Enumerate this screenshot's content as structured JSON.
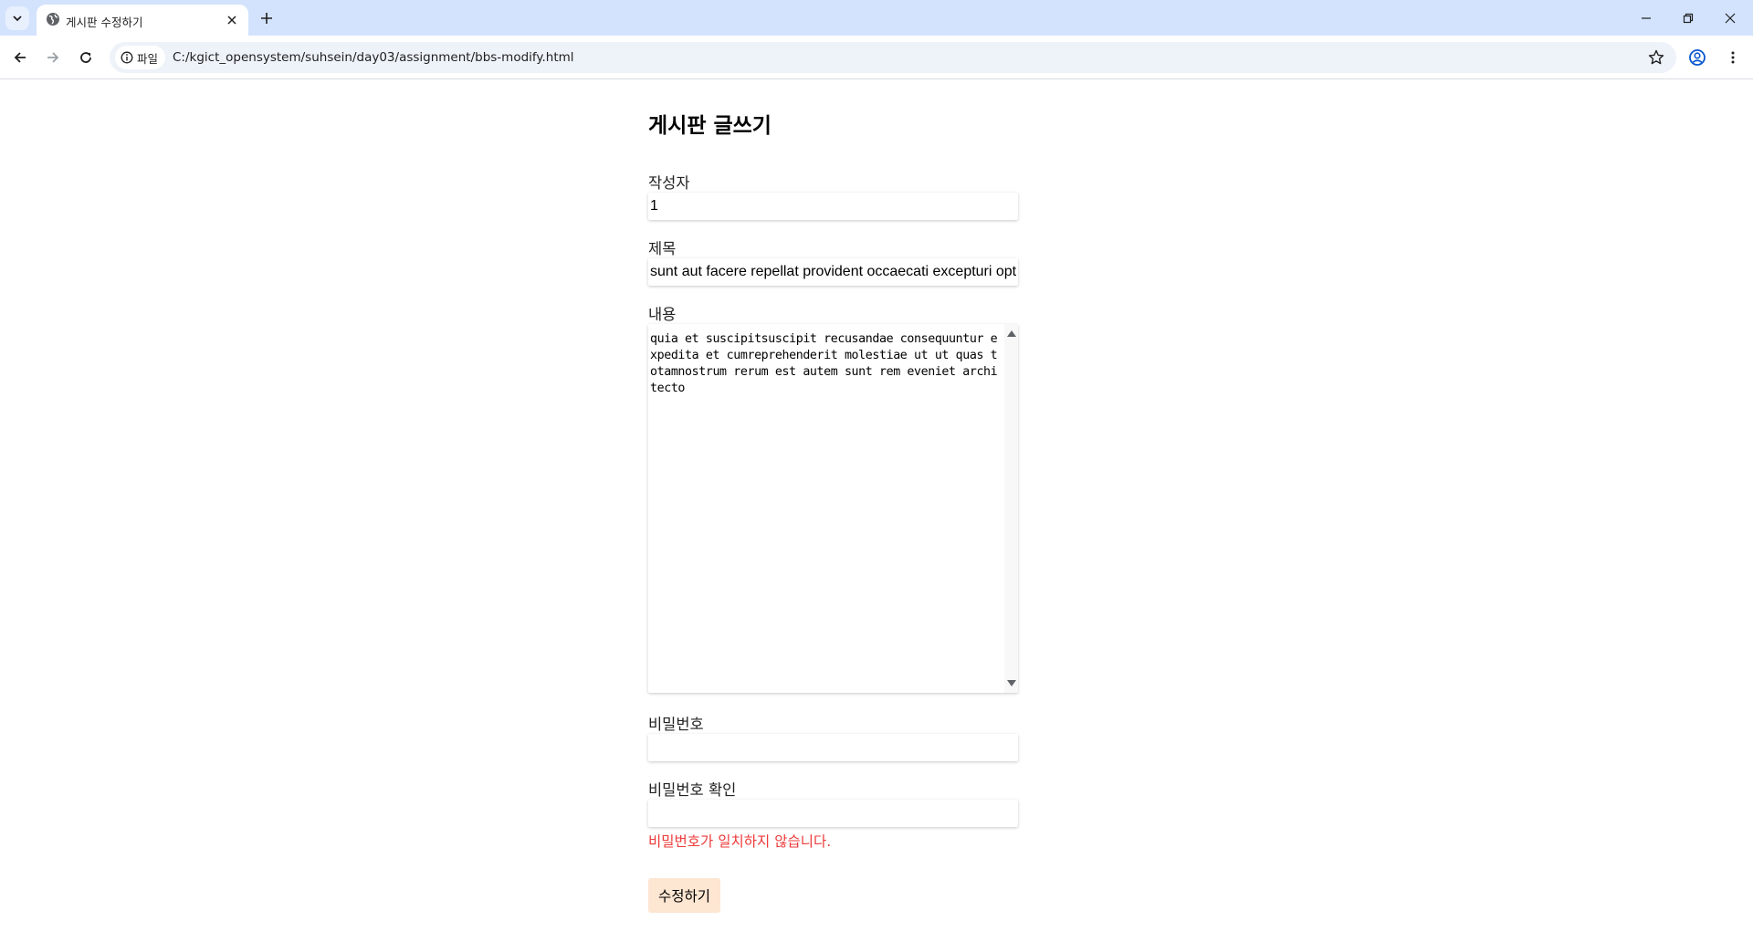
{
  "browser": {
    "tab_title": "게시판 수정하기",
    "security_chip_label": "파일",
    "url": "C:/kgict_opensystem/suhsein/day03/assignment/bbs-modify.html"
  },
  "form": {
    "heading": "게시판 글쓰기",
    "author_label": "작성자",
    "author_value": "1",
    "title_label": "제목",
    "title_value": "sunt aut facere repellat provident occaecati excepturi optio reprehenderit",
    "content_label": "내용",
    "content_value": "quia et suscipitsuscipit recusandae consequuntur expedita et cumreprehenderit molestiae ut ut quas totamnostrum rerum est autem sunt rem eveniet architecto",
    "password_label": "비밀번호",
    "password_value": "",
    "password_confirm_label": "비밀번호 확인",
    "password_confirm_value": "",
    "error_message": "비밀번호가 일치하지 않습니다.",
    "submit_label": "수정하기"
  }
}
